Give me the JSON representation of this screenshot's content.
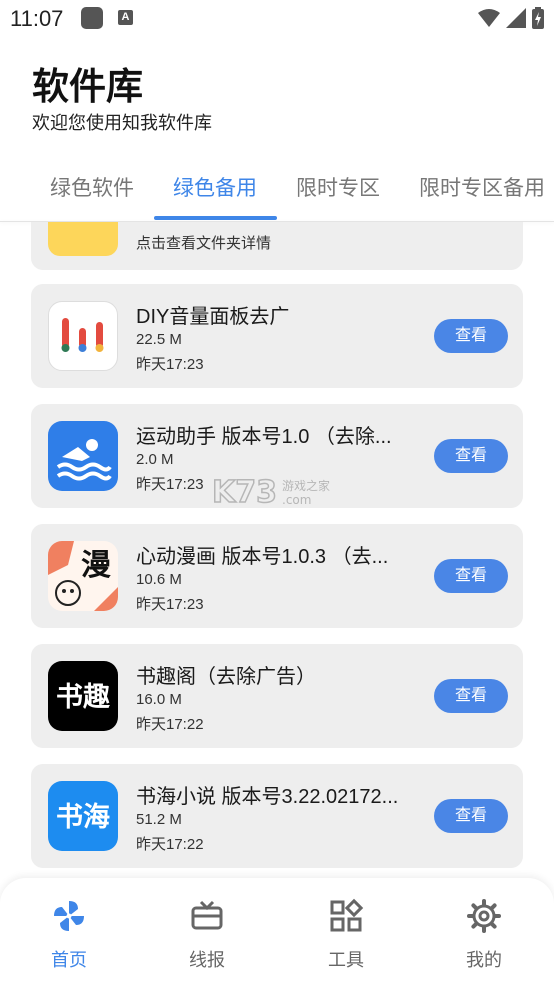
{
  "status_bar": {
    "time": "11:07"
  },
  "header": {
    "title": "软件库",
    "subtitle": "欢迎您使用知我软件库"
  },
  "tabs": [
    {
      "label": "绿色软件"
    },
    {
      "label": "绿色备用"
    },
    {
      "label": "限时专区"
    },
    {
      "label": "限时专区备用"
    }
  ],
  "active_tab": "绿色备用",
  "folder_card": {
    "description": "点击查看文件夹详情"
  },
  "apps": [
    {
      "name": "DIY音量面板去广",
      "size": "22.5 M",
      "time": "昨天17:23",
      "button": "查看",
      "icon": "volume-panel-icon"
    },
    {
      "name": "运动助手 版本号1.0 （去除...",
      "size": "2.0 M",
      "time": "昨天17:23",
      "button": "查看",
      "icon": "swimmer-icon"
    },
    {
      "name": "心动漫画 版本号1.0.3 （去...",
      "size": "10.6 M",
      "time": "昨天17:23",
      "button": "查看",
      "icon": "manga-icon",
      "icon_text": "漫"
    },
    {
      "name": "书趣阁（去除广告）",
      "size": "16.0 M",
      "time": "昨天17:22",
      "button": "查看",
      "icon": "shuqu-icon",
      "icon_text": "书趣"
    },
    {
      "name": "书海小说 版本号3.22.02172...",
      "size": "51.2 M",
      "time": "昨天17:22",
      "button": "查看",
      "icon": "shuhai-icon",
      "icon_text": "书海"
    }
  ],
  "watermark": {
    "text": "K73",
    "sub1": "游戏之家",
    "sub2": ".com"
  },
  "bottom_nav": [
    {
      "label": "首页",
      "icon": "pinwheel-icon",
      "active": true
    },
    {
      "label": "线报",
      "icon": "tv-icon",
      "active": false
    },
    {
      "label": "工具",
      "icon": "apps-grid-icon",
      "active": false
    },
    {
      "label": "我的",
      "icon": "gear-icon",
      "active": false
    }
  ],
  "colors": {
    "accent": "#3f86e8",
    "button": "#4a86e6",
    "card_bg": "#eeeeee",
    "folder_yellow": "#fdd65a"
  }
}
